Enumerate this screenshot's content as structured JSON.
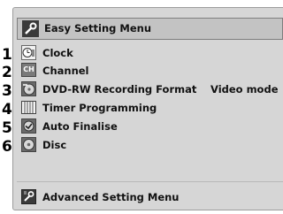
{
  "menu": {
    "title": "Easy Setting Menu",
    "items": [
      {
        "num": "1",
        "icon": "clock-icon",
        "label": "Clock",
        "value": ""
      },
      {
        "num": "2",
        "icon": "channel-icon",
        "label": "Channel",
        "value": ""
      },
      {
        "num": "3",
        "icon": "dvd-rw-icon",
        "label": "DVD-RW Recording Format",
        "value": "Video mode"
      },
      {
        "num": "4",
        "icon": "timer-icon",
        "label": "Timer Programming",
        "value": ""
      },
      {
        "num": "5",
        "icon": "finalise-icon",
        "label": "Auto Finalise",
        "value": ""
      },
      {
        "num": "6",
        "icon": "disc-icon",
        "label": "Disc",
        "value": ""
      }
    ],
    "channel_icon_text": "CH",
    "advanced": {
      "label": "Advanced Setting Menu",
      "icon": "advanced-settings-icon"
    }
  }
}
